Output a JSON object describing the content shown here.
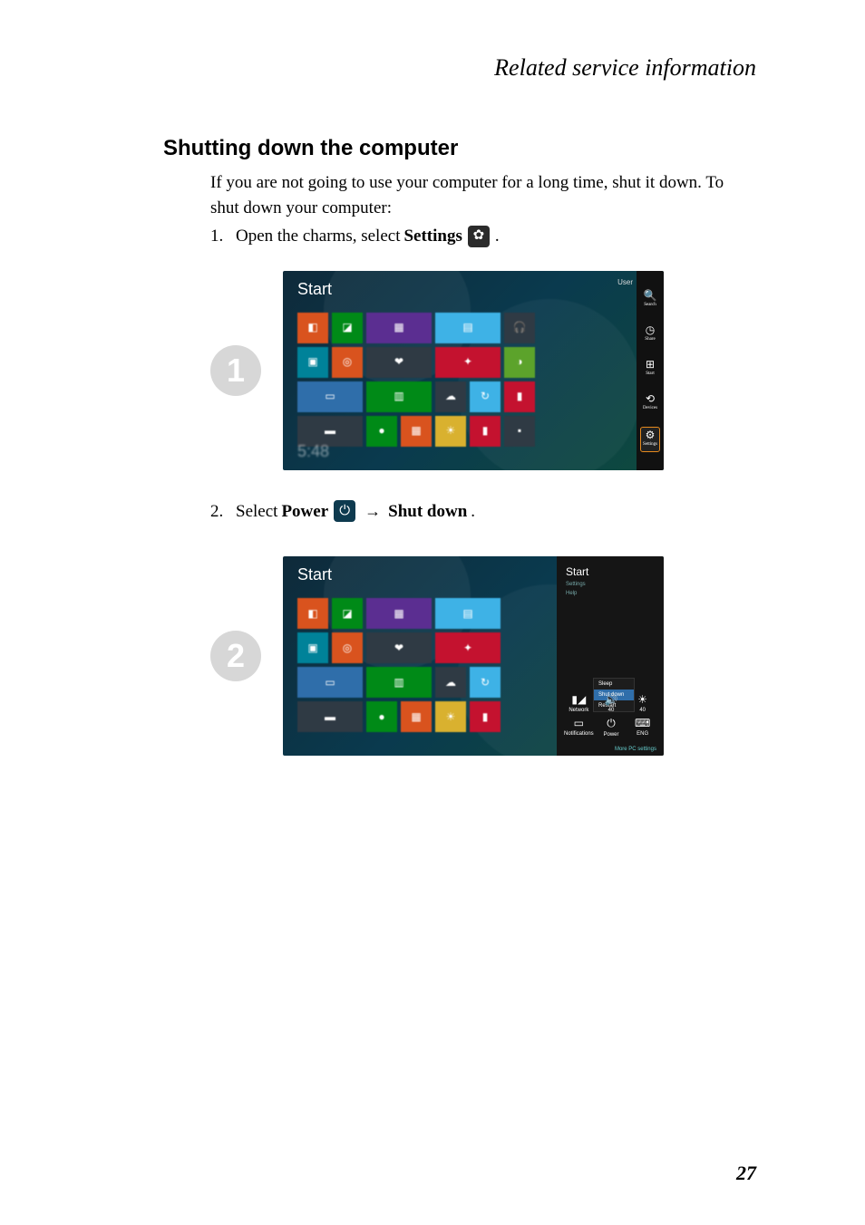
{
  "header": {
    "running_head": "Related service information"
  },
  "section": {
    "title": "Shutting down the computer",
    "intro": "If you are not going to use your computer for a long time, shut it down. To shut down your computer:"
  },
  "steps": {
    "s1": {
      "num": "1.",
      "pre": "Open the charms, select ",
      "bold": "Settings",
      "post": " ."
    },
    "s2": {
      "num": "2.",
      "pre": "Select ",
      "bold1": "Power",
      "arrow": "→",
      "bold2": "Shut down",
      "post": "."
    }
  },
  "callouts": {
    "c1": "1",
    "c2": "2"
  },
  "figure1": {
    "start_label": "Start",
    "user_label": "User",
    "clock": "5:48",
    "charms": {
      "search": {
        "label": "Search"
      },
      "share": {
        "label": "Share"
      },
      "start": {
        "label": "Start"
      },
      "devices": {
        "label": "Devices"
      },
      "settings": {
        "label": "Settings"
      }
    }
  },
  "figure2": {
    "start_label": "Start",
    "flyout_title": "Start",
    "flyout_subtitle1": "Settings",
    "flyout_subtitle2": "Help",
    "grid": {
      "network": "Network",
      "volume": "40",
      "brightness": "40",
      "notifications": "Notifications",
      "power": "Power",
      "keyboard": "ENG"
    },
    "more": "More PC settings",
    "power_menu": {
      "sleep": "Sleep",
      "shutdown": "Shut down",
      "restart": "Restart"
    }
  },
  "page_number": "27"
}
